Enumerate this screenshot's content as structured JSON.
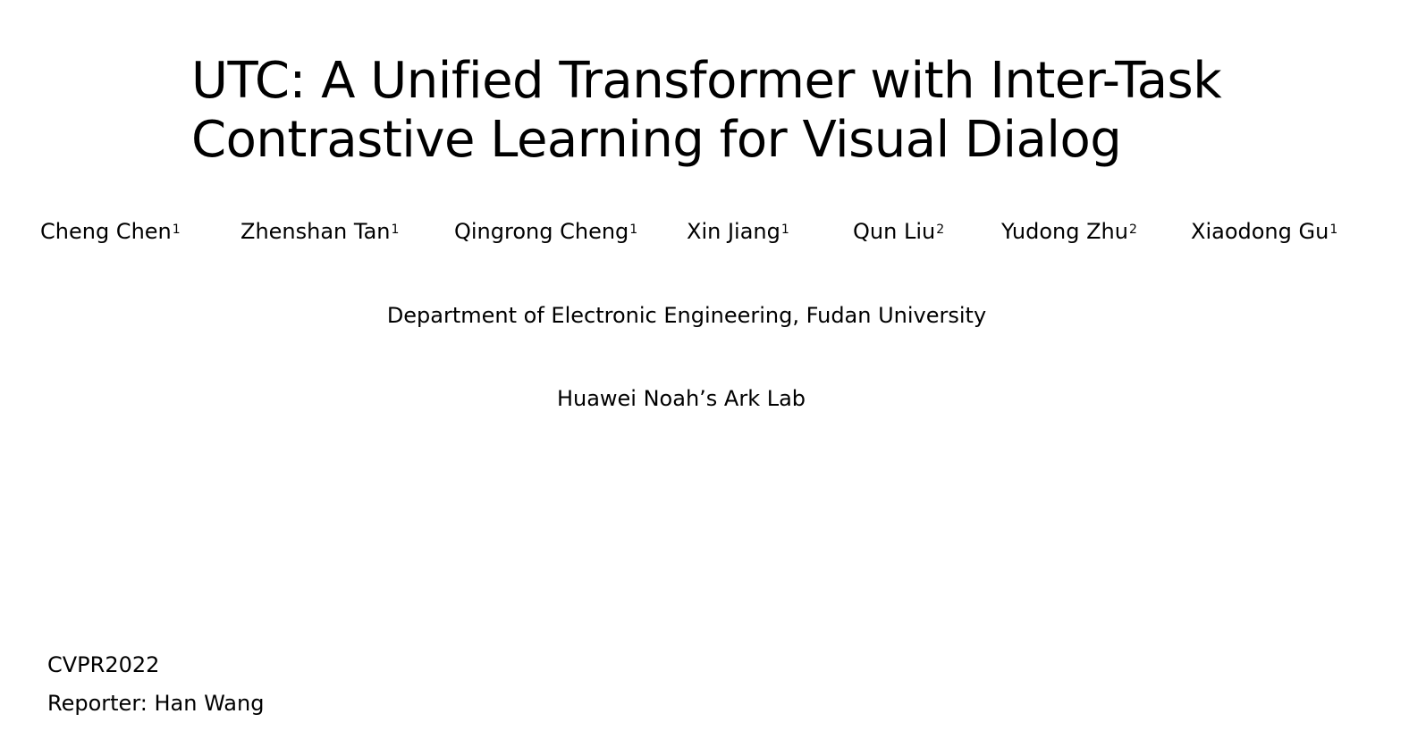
{
  "slide": {
    "title_line1": "UTC: A Unified Transformer with Inter-Task",
    "title_line2": "Contrastive Learning for Visual Dialog",
    "authors": [
      {
        "name": "Cheng Chen",
        "sup": "1"
      },
      {
        "name": "Zhenshan Tan",
        "sup": "1"
      },
      {
        "name": "Qingrong Cheng",
        "sup": "1"
      },
      {
        "name": "Xin Jiang",
        "sup": "1"
      },
      {
        "name": "Qun Liu",
        "sup": "2"
      },
      {
        "name": "Yudong Zhu",
        "sup": "2"
      },
      {
        "name": "Xiaodong Gu",
        "sup": "1"
      }
    ],
    "affiliation_1": "Department of Electronic Engineering, Fudan University",
    "affiliation_2": "Huawei Noah’s Ark Lab",
    "venue": "CVPR2022",
    "reporter": "Reporter:  Han Wang"
  }
}
